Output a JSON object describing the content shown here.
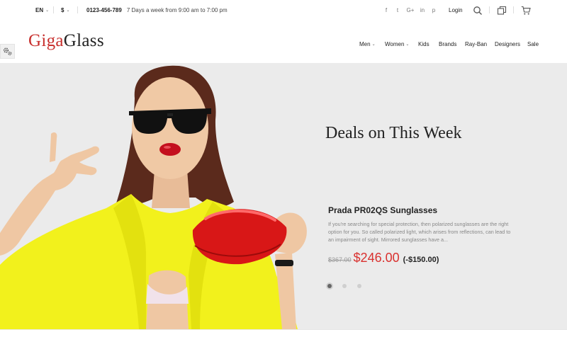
{
  "topbar": {
    "language": "EN",
    "currency": "$",
    "phone": "0123-456-789",
    "hours": "7 Days a week from 9:00 am to 7:00 pm",
    "social": [
      "f",
      "t",
      "G+",
      "in",
      "p"
    ],
    "login_label": "Login"
  },
  "logo": {
    "part1": "Giga",
    "part2": "Glass"
  },
  "nav": {
    "items": [
      {
        "label": "Men",
        "dropdown": true
      },
      {
        "label": "Women",
        "dropdown": true
      },
      {
        "label": "Kids"
      },
      {
        "label": "Brands"
      },
      {
        "label": "Ray-Ban"
      },
      {
        "label": "Designers"
      },
      {
        "label": "Sale"
      }
    ]
  },
  "hero": {
    "title": "Deals on This Week",
    "product_title": "Prada PR02QS Sunglasses",
    "description": "If you're searching for special protection, then polarized sunglasses are the right option for you. So called polarized light, which arises from reflections, can lead to an impairment of sight. Mirrored sunglasses have a...",
    "old_price": "$367.00",
    "new_price": "$246.00",
    "discount": "(-$150.00)",
    "slides": {
      "count": 3,
      "active": 1
    }
  },
  "colors": {
    "brand_red": "#c8302e",
    "price_red": "#d9312f",
    "hero_bg": "#ebebeb",
    "jacket_yellow": "#f2f11c"
  },
  "icons": [
    "chevron-down-icon",
    "facebook-icon",
    "twitter-icon",
    "google-plus-icon",
    "linkedin-icon",
    "pinterest-icon",
    "search-icon",
    "compare-icon",
    "cart-icon",
    "gear-icon"
  ]
}
